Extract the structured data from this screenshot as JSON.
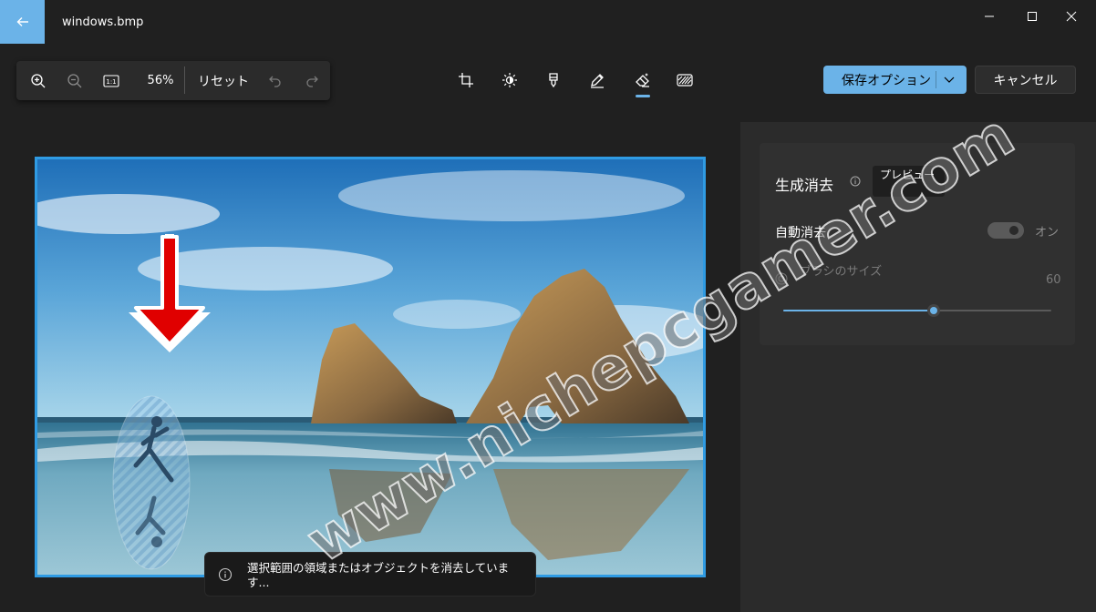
{
  "window": {
    "title": "windows.bmp"
  },
  "zoombar": {
    "zoom_value": "56%",
    "reset_label": "リセット"
  },
  "toolbar": {
    "tools": [
      "crop-icon",
      "brightness-icon",
      "marker-icon",
      "pen-icon",
      "eraser-icon",
      "blur-icon"
    ],
    "active_tool": "eraser-icon",
    "save_label": "保存オプション",
    "cancel_label": "キャンセル"
  },
  "toast": {
    "message": "選択範囲の領域またはオブジェクトを消去しています..."
  },
  "panel": {
    "title": "生成消去",
    "preview_badge": "プレビュー",
    "auto_erase_label": "自動消去",
    "auto_erase_state": "オン",
    "brush_size_label": "ブラシのサイズ",
    "brush_size_value": "60",
    "brush_size_fraction": 0.56
  },
  "watermark": "www.nichepcgamer.com",
  "colors": {
    "accent": "#6bb3e8",
    "background": "#202020",
    "panel": "#2b2b2b",
    "arrow": "#e00000"
  }
}
